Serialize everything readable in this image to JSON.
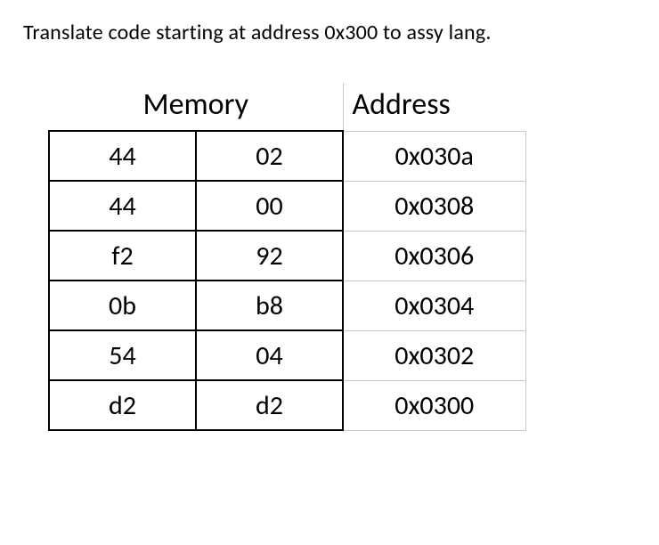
{
  "prompt": "Translate code  starting at address 0x300 to assy lang.",
  "headers": {
    "memory": "Memory",
    "address": "Address"
  },
  "rows": [
    {
      "mem_hi": "44",
      "mem_lo": "02",
      "addr": "0x030a"
    },
    {
      "mem_hi": "44",
      "mem_lo": "00",
      "addr": "0x0308"
    },
    {
      "mem_hi": "f2",
      "mem_lo": "92",
      "addr": "0x0306"
    },
    {
      "mem_hi": "0b",
      "mem_lo": "b8",
      "addr": "0x0304"
    },
    {
      "mem_hi": "54",
      "mem_lo": "04",
      "addr": "0x0302"
    },
    {
      "mem_hi": "d2",
      "mem_lo": "d2",
      "addr": "0x0300"
    }
  ]
}
